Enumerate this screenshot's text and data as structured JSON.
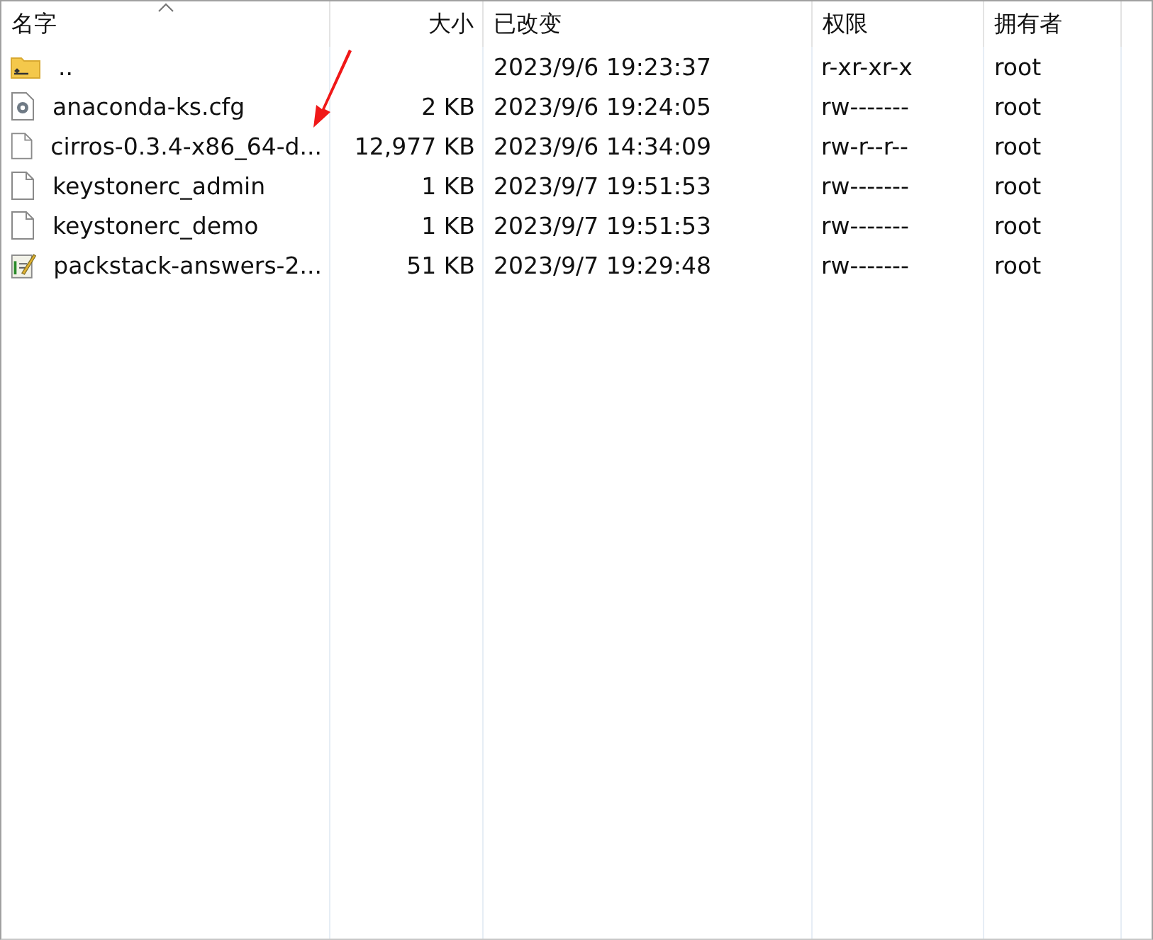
{
  "table": {
    "columns": [
      {
        "label": "名字",
        "sorted": true
      },
      {
        "label": "大小",
        "sorted": false
      },
      {
        "label": "已改变",
        "sorted": false
      },
      {
        "label": "权限",
        "sorted": false
      },
      {
        "label": "拥有者",
        "sorted": false
      }
    ],
    "rows": [
      {
        "kind": "parent",
        "name": "..",
        "size": "",
        "modified": "2023/9/6 19:23:37",
        "permissions": "r-xr-xr-x",
        "owner": "root"
      },
      {
        "kind": "config",
        "name": "anaconda-ks.cfg",
        "size": "2 KB",
        "modified": "2023/9/6 19:24:05",
        "permissions": "rw-------",
        "owner": "root"
      },
      {
        "kind": "file",
        "name": "cirros-0.3.4-x86_64-d...",
        "size": "12,977 KB",
        "modified": "2023/9/6 14:34:09",
        "permissions": "rw-r--r--",
        "owner": "root"
      },
      {
        "kind": "file",
        "name": "keystonerc_admin",
        "size": "1 KB",
        "modified": "2023/9/7 19:51:53",
        "permissions": "rw-------",
        "owner": "root"
      },
      {
        "kind": "file",
        "name": "keystonerc_demo",
        "size": "1 KB",
        "modified": "2023/9/7 19:51:53",
        "permissions": "rw-------",
        "owner": "root"
      },
      {
        "kind": "answers",
        "name": "packstack-answers-2...",
        "size": "51 KB",
        "modified": "2023/9/7 19:29:48",
        "permissions": "rw-------",
        "owner": "root"
      }
    ]
  }
}
